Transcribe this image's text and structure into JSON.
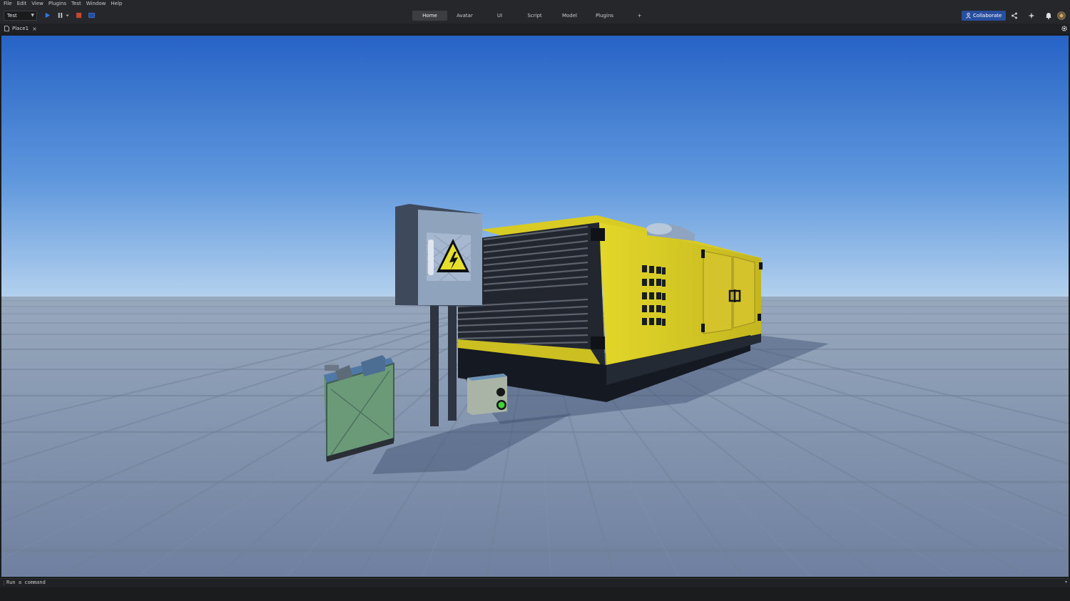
{
  "menu": [
    "File",
    "Edit",
    "View",
    "Plugins",
    "Test",
    "Window",
    "Help"
  ],
  "toolbar": {
    "mode_value": "Test",
    "tabs": [
      "Home",
      "Avatar",
      "UI",
      "Script",
      "Model",
      "Plugins"
    ],
    "active_tab": "Home",
    "add_tab_label": "+",
    "collaborate_label": "Collaborate"
  },
  "document": {
    "tab_title": "Place1",
    "close_glyph": "×"
  },
  "command_bar": {
    "placeholder": "Run a command",
    "grip": "⋮",
    "chevron": "▾"
  },
  "icons": {
    "play": "play-icon",
    "pause": "pause-icon",
    "stop": "stop-icon",
    "screen": "screen-icon",
    "share": "share-icon",
    "sparkle": "sparkle-icon",
    "bell": "bell-icon",
    "avatar": "avatar-icon",
    "gear": "gear-icon",
    "file": "file-icon",
    "person": "person-icon"
  },
  "colors": {
    "accent": "#284f9f",
    "play": "#2f7de1",
    "stop": "#c4472f",
    "generator_yellow": "#d8cc2a",
    "sky_top": "#2a66c8",
    "ground": "#7f90a6"
  }
}
